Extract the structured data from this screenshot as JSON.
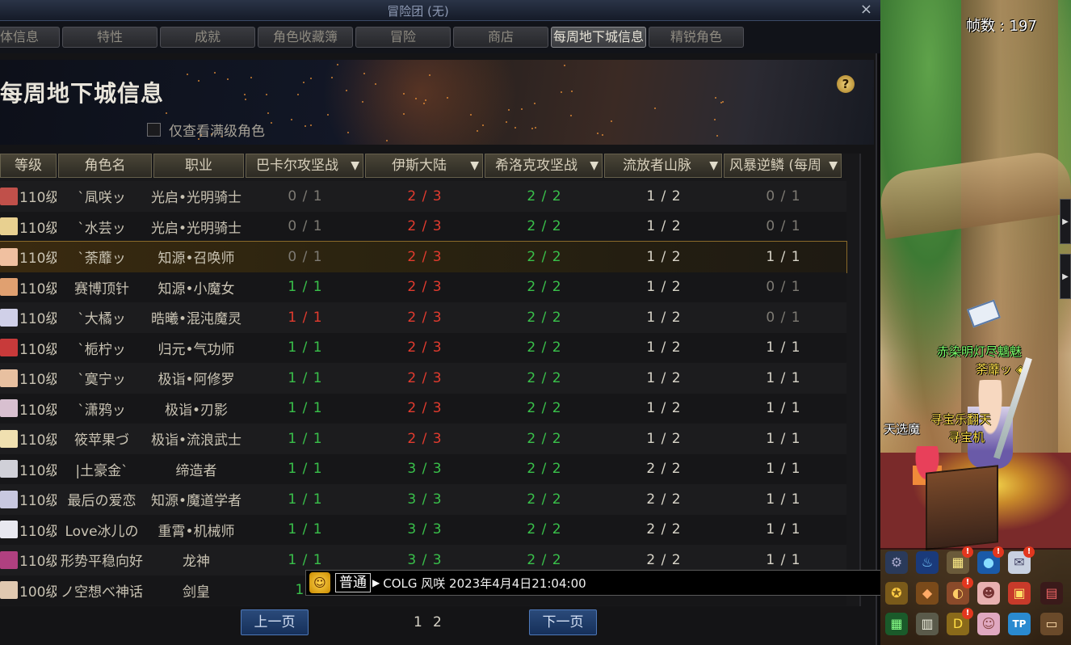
{
  "window": {
    "title": "冒险团 (无)",
    "close": "×"
  },
  "tabs": [
    {
      "label": "体信息",
      "active": false
    },
    {
      "label": "特性",
      "active": false
    },
    {
      "label": "成就",
      "active": false
    },
    {
      "label": "角色收藏簿",
      "active": false
    },
    {
      "label": "冒险",
      "active": false
    },
    {
      "label": "商店",
      "active": false
    },
    {
      "label": "每周地下城信息",
      "active": true
    },
    {
      "label": "精锐角色",
      "active": false
    }
  ],
  "banner": {
    "title": "每周地下城信息",
    "help": "?",
    "filter_label": "仅查看满级角色",
    "filter_checked": false
  },
  "table": {
    "headers": {
      "level": "等级",
      "name": "角色名",
      "job": "职业",
      "d1": "巴卡尔攻坚战",
      "d2": "伊斯大陆",
      "d3": "希洛克攻坚战",
      "d4": "流放者山脉",
      "d5": "风暴逆鳞 (每周"
    },
    "sort_arrow": "▼",
    "rows": [
      {
        "level": "110级",
        "name": "`凬咲ッ",
        "job": "光启•光明骑士",
        "d1": "0 / 1",
        "d2": "2 / 3",
        "d3": "2 / 2",
        "d4": "1 / 2",
        "d5": "0 / 1",
        "s1": "gray",
        "s2": "red",
        "s3": "green",
        "s4": "white",
        "s5": "gray",
        "avatar": "#c0504a"
      },
      {
        "level": "110级",
        "name": "`水芸ッ",
        "job": "光启•光明骑士",
        "d1": "0 / 1",
        "d2": "2 / 3",
        "d3": "2 / 2",
        "d4": "1 / 2",
        "d5": "0 / 1",
        "s1": "gray",
        "s2": "red",
        "s3": "green",
        "s4": "white",
        "s5": "gray",
        "avatar": "#e8d090"
      },
      {
        "level": "110级",
        "name": "`荼蘼ッ",
        "job": "知源•召唤师",
        "d1": "0 / 1",
        "d2": "2 / 3",
        "d3": "2 / 2",
        "d4": "1 / 2",
        "d5": "1 / 1",
        "s1": "gray",
        "s2": "red",
        "s3": "green",
        "s4": "white",
        "s5": "white",
        "avatar": "#f0c0a0",
        "selected": true
      },
      {
        "level": "110级",
        "name": "赛博顶针",
        "job": "知源•小魔女",
        "d1": "1 / 1",
        "d2": "2 / 3",
        "d3": "2 / 2",
        "d4": "1 / 2",
        "d5": "0 / 1",
        "s1": "green",
        "s2": "red",
        "s3": "green",
        "s4": "white",
        "s5": "gray",
        "avatar": "#e0a070"
      },
      {
        "level": "110级",
        "name": "`大橘ッ",
        "job": "晧曦•混沌魔灵",
        "d1": "1 / 1",
        "d2": "2 / 3",
        "d3": "2 / 2",
        "d4": "1 / 2",
        "d5": "0 / 1",
        "s1": "red",
        "s2": "red",
        "s3": "green",
        "s4": "white",
        "s5": "gray",
        "avatar": "#d0d0e8"
      },
      {
        "level": "110级",
        "name": "`栀柠ッ",
        "job": "归元•气功师",
        "d1": "1 / 1",
        "d2": "2 / 3",
        "d3": "2 / 2",
        "d4": "1 / 2",
        "d5": "1 / 1",
        "s1": "green",
        "s2": "red",
        "s3": "green",
        "s4": "white",
        "s5": "white",
        "avatar": "#c83a3a"
      },
      {
        "level": "110级",
        "name": "`寞宁ッ",
        "job": "极诣•阿修罗",
        "d1": "1 / 1",
        "d2": "2 / 3",
        "d3": "2 / 2",
        "d4": "1 / 2",
        "d5": "1 / 1",
        "s1": "green",
        "s2": "red",
        "s3": "green",
        "s4": "white",
        "s5": "white",
        "avatar": "#e8c0a0"
      },
      {
        "level": "110级",
        "name": "`潇鸦ッ",
        "job": "极诣•刃影",
        "d1": "1 / 1",
        "d2": "2 / 3",
        "d3": "2 / 2",
        "d4": "1 / 2",
        "d5": "1 / 1",
        "s1": "green",
        "s2": "red",
        "s3": "green",
        "s4": "white",
        "s5": "white",
        "avatar": "#d8c0d0"
      },
      {
        "level": "110级",
        "name": "筱苹果づ",
        "job": "极诣•流浪武士",
        "d1": "1 / 1",
        "d2": "2 / 3",
        "d3": "2 / 2",
        "d4": "1 / 2",
        "d5": "1 / 1",
        "s1": "green",
        "s2": "red",
        "s3": "green",
        "s4": "white",
        "s5": "white",
        "avatar": "#f0e0b0"
      },
      {
        "level": "110级",
        "name": "|土豪金`",
        "job": "缔造者",
        "d1": "1 / 1",
        "d2": "3 / 3",
        "d3": "2 / 2",
        "d4": "2 / 2",
        "d5": "1 / 1",
        "s1": "green",
        "s2": "green",
        "s3": "green",
        "s4": "white",
        "s5": "white",
        "avatar": "#d0d0d8"
      },
      {
        "level": "110级",
        "name": "最后の爱恋",
        "job": "知源•魔道学者",
        "d1": "1 / 1",
        "d2": "3 / 3",
        "d3": "2 / 2",
        "d4": "2 / 2",
        "d5": "1 / 1",
        "s1": "green",
        "s2": "green",
        "s3": "green",
        "s4": "white",
        "s5": "white",
        "avatar": "#c8c8e0"
      },
      {
        "level": "110级",
        "name": "Love冰儿の",
        "job": "重霄•机械师",
        "d1": "1 / 1",
        "d2": "3 / 3",
        "d3": "2 / 2",
        "d4": "2 / 2",
        "d5": "1 / 1",
        "s1": "green",
        "s2": "green",
        "s3": "green",
        "s4": "white",
        "s5": "white",
        "avatar": "#e8e8f0"
      },
      {
        "level": "110级",
        "name": "形势平稳向好",
        "job": "龙神",
        "d1": "1 / 1",
        "d2": "3 / 3",
        "d3": "2 / 2",
        "d4": "2 / 2",
        "d5": "1 / 1",
        "s1": "green",
        "s2": "green",
        "s3": "green",
        "s4": "white",
        "s5": "white",
        "avatar": "#b04080"
      },
      {
        "level": "100级",
        "name": "ノ空想べ神话",
        "job": "剑皇",
        "d1": "1 /",
        "d2": "",
        "d3": "",
        "d4": "",
        "d5": "",
        "s1": "green",
        "s2": "gray",
        "s3": "gray",
        "s4": "gray",
        "s5": "gray",
        "avatar": "#e0c8b0"
      }
    ]
  },
  "pager": {
    "prev": "上一页",
    "next": "下一页",
    "pages": [
      "1",
      "2"
    ]
  },
  "chat": {
    "emoji": "☺",
    "channel": "普通",
    "arrow": "▶",
    "text": "COLG 风咲 2023年4月4日21:04:00"
  },
  "game": {
    "fps": "帧数 : 197",
    "tags": [
      "赤染明灯尽魑魅",
      "荼蘼ッ ◈",
      "寻宝乐翻天",
      "寻宝机",
      "天选魔"
    ],
    "side_handle": "▶",
    "icons": [
      "gear-icon",
      "blue-flame-icon",
      "card-icon",
      "water-drop-icon",
      "mail-icon",
      "trophy-icon",
      "bag-icon",
      "map-icon",
      "avatar-icon",
      "gift-icon",
      "book-icon",
      "calendar-icon",
      "notebook-icon",
      "dungeon-icon",
      "character-icon",
      "tp-icon",
      "scroll-icon"
    ]
  }
}
